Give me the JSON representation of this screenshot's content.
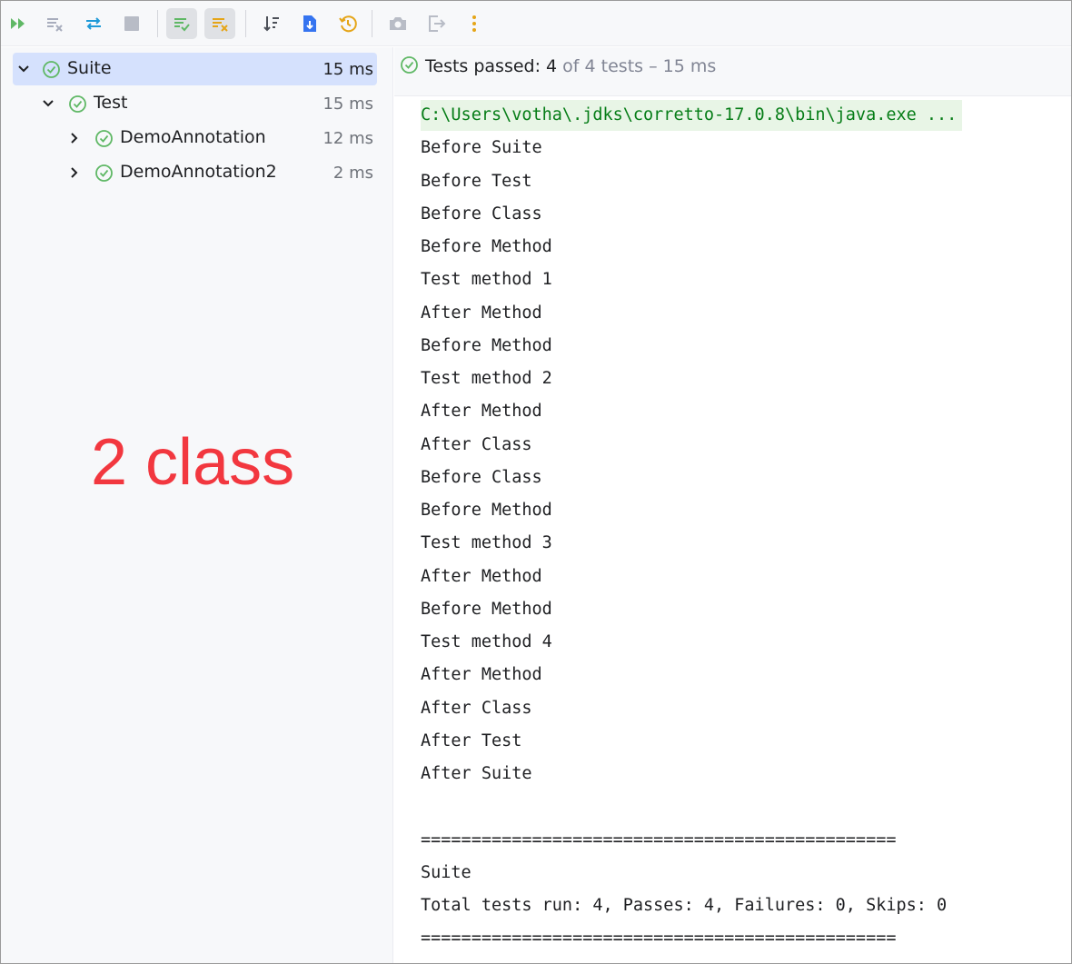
{
  "toolbar": {
    "buttons": [
      {
        "name": "rerun-button",
        "icon": "double-play-icon"
      },
      {
        "name": "rerun-failed-button",
        "icon": "list-x-icon"
      },
      {
        "name": "toggle-auto-test-button",
        "icon": "swap-arrows-icon"
      },
      {
        "name": "stop-button",
        "icon": "stop-icon"
      },
      {
        "name": "show-passed-button",
        "icon": "list-check-icon"
      },
      {
        "name": "show-ignored-button",
        "icon": "list-x-icon"
      },
      {
        "name": "sort-button",
        "icon": "sort-icon"
      },
      {
        "name": "import-tests-button",
        "icon": "import-file-icon"
      },
      {
        "name": "history-button",
        "icon": "history-icon"
      },
      {
        "name": "screenshot-button",
        "icon": "camera-icon"
      },
      {
        "name": "export-button",
        "icon": "export-icon"
      },
      {
        "name": "more-button",
        "icon": "kebab-icon"
      }
    ]
  },
  "tree": {
    "items": [
      {
        "label": "Suite",
        "time": "15 ms",
        "expanded": true,
        "selected": true
      },
      {
        "label": "Test",
        "time": "15 ms",
        "expanded": true,
        "selected": false
      },
      {
        "label": "DemoAnnotation",
        "time": "12 ms",
        "expanded": false,
        "selected": false
      },
      {
        "label": "DemoAnnotation2",
        "time": "2 ms",
        "expanded": false,
        "selected": false
      }
    ]
  },
  "annotation": "2 class",
  "status": {
    "prefix": "Tests passed: ",
    "passed": "4",
    "suffix": " of 4 tests – 15 ms"
  },
  "console": {
    "command": "C:\\Users\\votha\\.jdks\\corretto-17.0.8\\bin\\java.exe ...",
    "lines": [
      "Before Suite",
      "Before Test",
      "Before Class",
      "Before Method",
      "Test method 1",
      "After Method",
      "Before Method",
      "Test method 2",
      "After Method",
      "After Class",
      "Before Class",
      "Before Method",
      "Test method 3",
      "After Method",
      "Before Method",
      "Test method 4",
      "After Method",
      "After Class",
      "After Test",
      "After Suite",
      "",
      "===============================================",
      "Suite",
      "Total tests run: 4, Passes: 4, Failures: 0, Skips: 0",
      "==============================================="
    ]
  },
  "colors": {
    "pass_green": "#5fb865",
    "accent_blue": "#3574f0",
    "annotation_red": "#f2373f",
    "selection": "#d5e1fd"
  }
}
